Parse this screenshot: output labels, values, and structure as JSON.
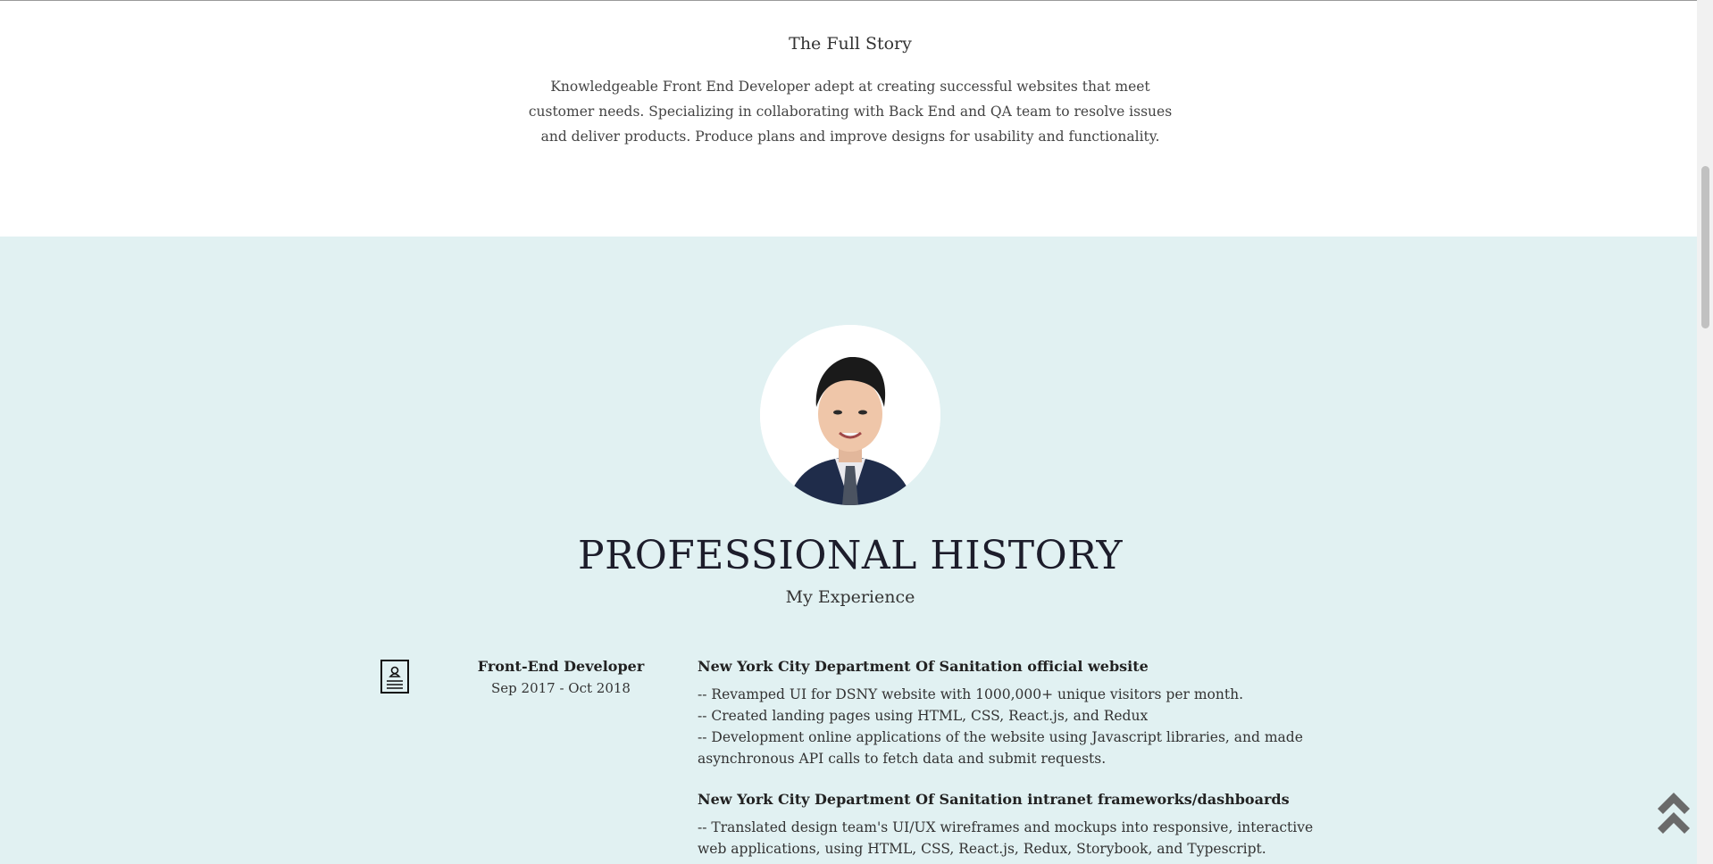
{
  "story": {
    "title": "The Full Story",
    "text": "Knowledgeable Front End Developer adept at creating successful websites that meet customer needs. Specializing in collaborating with Back End and QA team to resolve issues and deliver products. Produce plans and improve designs for usability and functionality."
  },
  "history": {
    "title": "PROFESSIONAL HISTORY",
    "subtitle": "My Experience",
    "job": {
      "role": "Front-End Developer",
      "dates": "Sep 2017 - Oct 2018",
      "icon": "resume-icon"
    },
    "projects": [
      {
        "title": "New York City Department Of Sanitation official website",
        "bullets": [
          "-- Revamped UI for DSNY website with 1000,000+ unique visitors per month.",
          "-- Created landing pages using HTML, CSS, React.js, and Redux",
          "-- Development online applications of the website using Javascript libraries, and made asynchronous API calls to fetch data and submit requests."
        ]
      },
      {
        "title": "New York City Department Of Sanitation intranet frameworks/dashboards",
        "bullets": [
          "-- Translated design team's UI/UX wireframes and mockups into responsive, interactive web applications, using HTML, CSS, React.js, Redux, Storybook, and Typescript."
        ]
      }
    ]
  },
  "controls": {
    "back_to_top_icon": "double-chevron-up-icon"
  },
  "colors": {
    "history_background": "#e1f1f2",
    "page_background": "#ffffff"
  }
}
